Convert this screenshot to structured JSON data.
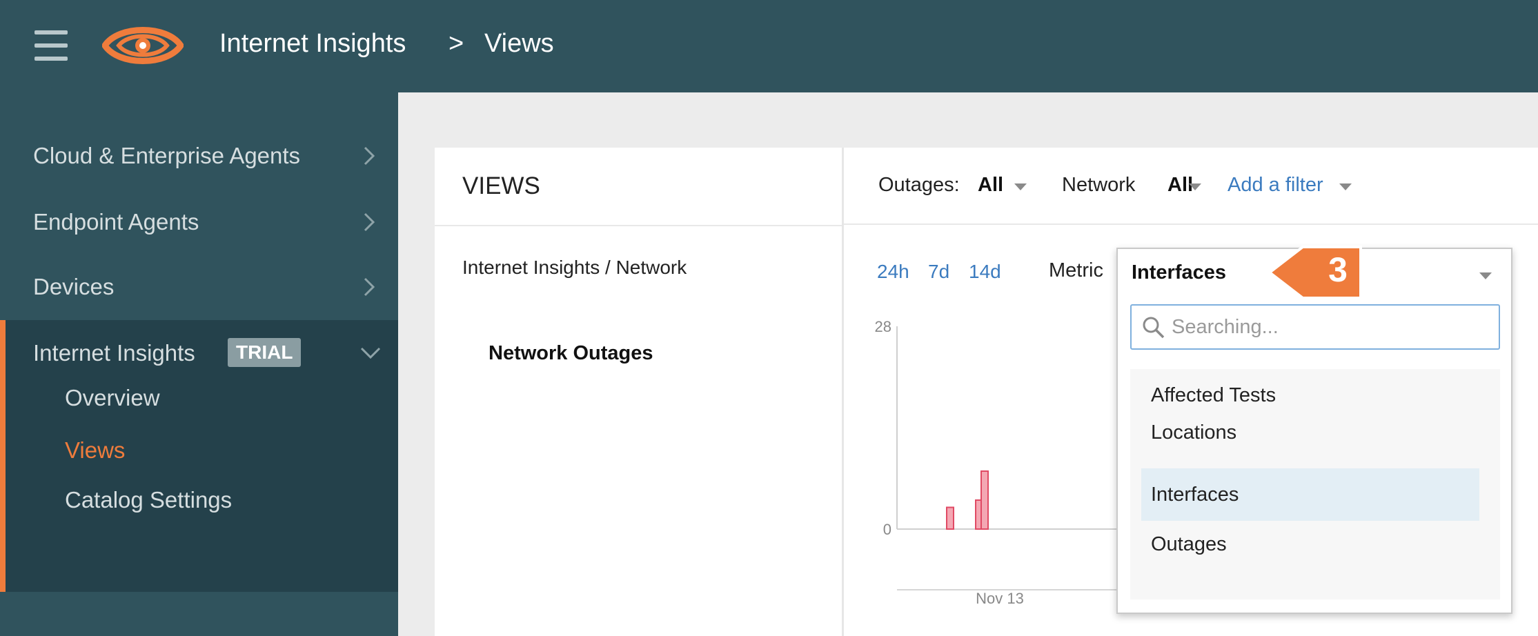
{
  "header": {
    "breadcrumb_root": "Internet Insights",
    "breadcrumb_separator": ">",
    "breadcrumb_current": "Views",
    "brand_color": "#30535d",
    "accent_color": "#ef7c3c"
  },
  "sidebar": {
    "items": [
      {
        "label": "Cloud & Enterprise Agents",
        "icon": "chevron-right-icon"
      },
      {
        "label": "Endpoint Agents",
        "icon": "chevron-right-icon"
      },
      {
        "label": "Devices",
        "icon": "chevron-right-icon"
      }
    ],
    "expanded": {
      "label": "Internet Insights",
      "badge": "TRIAL",
      "icon": "chevron-down-icon",
      "children": [
        {
          "label": "Overview",
          "active": false
        },
        {
          "label": "Views",
          "active": true
        },
        {
          "label": "Catalog Settings",
          "active": false
        }
      ]
    }
  },
  "views": {
    "title": "VIEWS",
    "breadcrumb": "Internet Insights / Network",
    "link": "Network Outages"
  },
  "filters": {
    "outages_label": "Outages:",
    "outages_value": "All",
    "network_label": "Network",
    "network_value": "All",
    "add_filter": "Add a filter"
  },
  "time_ranges": [
    "24h",
    "7d",
    "14d"
  ],
  "metric": {
    "label": "Metric",
    "selected": "Interfaces",
    "search_placeholder": "Searching...",
    "options": [
      {
        "label": "Affected Tests",
        "active": false
      },
      {
        "label": "Locations",
        "active": false
      },
      {
        "label": "Interfaces",
        "active": true
      },
      {
        "label": "Outages",
        "active": false
      }
    ]
  },
  "callout": {
    "number": "3",
    "color": "#ef7c3c"
  },
  "chart_data": {
    "type": "bar",
    "y_ticks": [
      "28",
      "0"
    ],
    "ylim": [
      0,
      28
    ],
    "x_tick_labels": [
      "Nov 13"
    ],
    "bars": [
      {
        "value": 3
      },
      {
        "value": 4
      },
      {
        "value": 8
      }
    ],
    "bar_color": "#f08a99"
  }
}
